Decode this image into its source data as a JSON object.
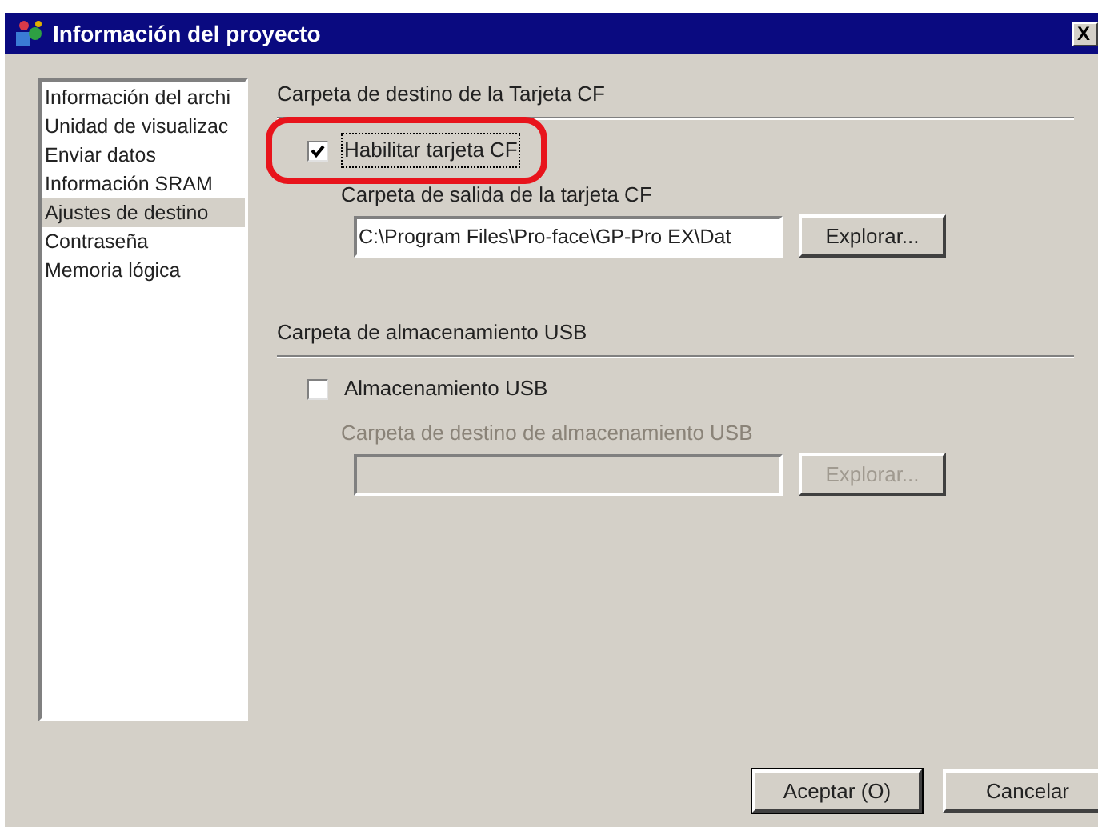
{
  "window": {
    "title": "Información del proyecto",
    "close_label": "X"
  },
  "sidebar": {
    "items": [
      {
        "label": "Información del archi",
        "selected": false
      },
      {
        "label": "Unidad de visualizac",
        "selected": false
      },
      {
        "label": "Enviar datos",
        "selected": false
      },
      {
        "label": "Información SRAM",
        "selected": false
      },
      {
        "label": "Ajustes de destino",
        "selected": true
      },
      {
        "label": "Contraseña",
        "selected": false
      },
      {
        "label": "Memoria lógica",
        "selected": false
      }
    ]
  },
  "sections": [
    {
      "title": "Carpeta de destino de la Tarjeta CF",
      "checkbox": {
        "label": "Habilitar tarjeta CF",
        "checked": true,
        "highlighted": true
      },
      "folder_label": "Carpeta de salida de la tarjeta CF",
      "path": "C:\\Program Files\\Pro-face\\GP-Pro EX\\Dat",
      "browse": "Explorar...",
      "disabled": false
    },
    {
      "title": "Carpeta de almacenamiento USB",
      "checkbox": {
        "label": "Almacenamiento USB",
        "checked": false,
        "highlighted": false
      },
      "folder_label": "Carpeta de destino de almacenamiento USB",
      "browse": "Explorar...",
      "disabled": true
    }
  ],
  "buttons": [
    {
      "label": "Aceptar (O)",
      "default": true
    },
    {
      "label": "Cancelar",
      "default": false
    }
  ]
}
